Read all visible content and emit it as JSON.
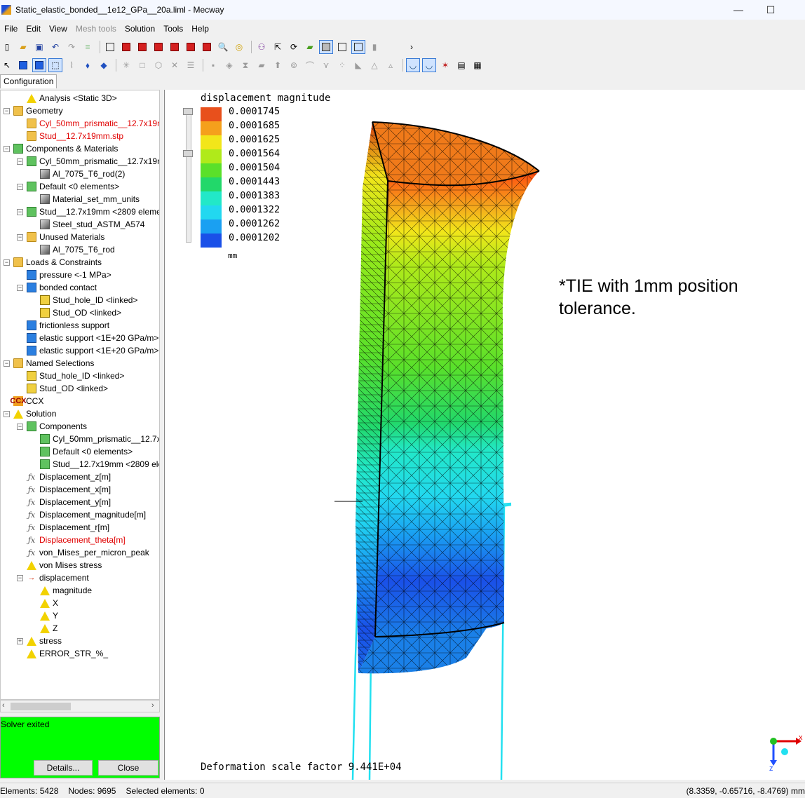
{
  "window": {
    "title": "Static_elastic_bonded__1e12_GPa__20a.liml - Mecway",
    "minimize": "—",
    "maximize": "☐"
  },
  "menu": [
    "File",
    "Edit",
    "View",
    "Mesh tools",
    "Solution",
    "Tools",
    "Help"
  ],
  "tab_label": "Configuration",
  "tree": [
    {
      "depth": 1,
      "icon": "analysis-icon",
      "label": "Analysis <Static 3D>",
      "red": false,
      "expander": ""
    },
    {
      "depth": 0,
      "icon": "folder-icon",
      "label": "Geometry",
      "red": false,
      "expander": "−"
    },
    {
      "depth": 1,
      "icon": "geometry-file-icon",
      "label": "Cyl_50mm_prismatic__12.7x19m",
      "red": true,
      "expander": ""
    },
    {
      "depth": 1,
      "icon": "geometry-file-icon",
      "label": "Stud__12.7x19mm.stp",
      "red": true,
      "expander": ""
    },
    {
      "depth": 0,
      "icon": "components-icon",
      "label": "Components & Materials",
      "red": false,
      "expander": "−"
    },
    {
      "depth": 1,
      "icon": "component-icon",
      "label": "Cyl_50mm_prismatic__12.7x19m",
      "red": false,
      "expander": "−"
    },
    {
      "depth": 2,
      "icon": "material-icon",
      "label": "Al_7075_T6_rod(2)",
      "red": false,
      "expander": ""
    },
    {
      "depth": 1,
      "icon": "component-icon",
      "label": "Default <0 elements>",
      "red": false,
      "expander": "−"
    },
    {
      "depth": 2,
      "icon": "material-icon",
      "label": "Material_set_mm_units",
      "red": false,
      "expander": ""
    },
    {
      "depth": 1,
      "icon": "component-icon",
      "label": "Stud__12.7x19mm <2809 elemer",
      "red": false,
      "expander": "−"
    },
    {
      "depth": 2,
      "icon": "material-icon",
      "label": "Steel_stud_ASTM_A574",
      "red": false,
      "expander": ""
    },
    {
      "depth": 1,
      "icon": "folder-icon",
      "label": "Unused Materials",
      "red": false,
      "expander": "−"
    },
    {
      "depth": 2,
      "icon": "material-icon",
      "label": "Al_7075_T6_rod",
      "red": false,
      "expander": ""
    },
    {
      "depth": 0,
      "icon": "loads-icon",
      "label": "Loads & Constraints",
      "red": false,
      "expander": "−"
    },
    {
      "depth": 1,
      "icon": "pressure-icon",
      "label": "pressure <-1 MPa>",
      "red": false,
      "expander": ""
    },
    {
      "depth": 1,
      "icon": "contact-icon",
      "label": "bonded contact",
      "red": false,
      "expander": "−"
    },
    {
      "depth": 2,
      "icon": "selection-icon",
      "label": "Stud_hole_ID <linked>",
      "red": false,
      "expander": ""
    },
    {
      "depth": 2,
      "icon": "selection-icon",
      "label": "Stud_OD <linked>",
      "red": false,
      "expander": ""
    },
    {
      "depth": 1,
      "icon": "support-icon",
      "label": "frictionless support",
      "red": false,
      "expander": ""
    },
    {
      "depth": 1,
      "icon": "support-icon",
      "label": "elastic support <1E+20 GPa/m>",
      "red": false,
      "expander": ""
    },
    {
      "depth": 1,
      "icon": "support-icon",
      "label": "elastic support <1E+20 GPa/m>",
      "red": false,
      "expander": ""
    },
    {
      "depth": 0,
      "icon": "named-selections-icon",
      "label": "Named Selections",
      "red": false,
      "expander": "−"
    },
    {
      "depth": 1,
      "icon": "selection-icon",
      "label": "Stud_hole_ID <linked>",
      "red": false,
      "expander": ""
    },
    {
      "depth": 1,
      "icon": "selection-icon",
      "label": "Stud_OD <linked>",
      "red": false,
      "expander": ""
    },
    {
      "depth": 0,
      "icon": "ccx-icon",
      "label": "CCX",
      "red": false,
      "expander": ""
    },
    {
      "depth": 0,
      "icon": "solution-icon",
      "label": "Solution",
      "red": false,
      "expander": "−"
    },
    {
      "depth": 1,
      "icon": "components-icon",
      "label": "Components",
      "red": false,
      "expander": "−"
    },
    {
      "depth": 2,
      "icon": "component-hidden-icon",
      "label": "Cyl_50mm_prismatic__12.7x1",
      "red": false,
      "expander": ""
    },
    {
      "depth": 2,
      "icon": "component-icon",
      "label": "Default <0 elements>",
      "red": false,
      "expander": ""
    },
    {
      "depth": 2,
      "icon": "component-icon",
      "label": "Stud__12.7x19mm <2809 ele",
      "red": false,
      "expander": ""
    },
    {
      "depth": 1,
      "icon": "formula-icon",
      "label": "Displacement_z[m]",
      "red": false,
      "expander": ""
    },
    {
      "depth": 1,
      "icon": "formula-icon",
      "label": "Displacement_x[m]",
      "red": false,
      "expander": ""
    },
    {
      "depth": 1,
      "icon": "formula-icon",
      "label": "Displacement_y[m]",
      "red": false,
      "expander": ""
    },
    {
      "depth": 1,
      "icon": "formula-icon",
      "label": "Displacement_magnitude[m]",
      "red": false,
      "expander": ""
    },
    {
      "depth": 1,
      "icon": "formula-icon",
      "label": "Displacement_r[m]",
      "red": false,
      "expander": ""
    },
    {
      "depth": 1,
      "icon": "formula-icon",
      "label": "Displacement_theta[m]",
      "red": true,
      "expander": ""
    },
    {
      "depth": 1,
      "icon": "formula-icon",
      "label": "von_Mises_per_micron_peak",
      "red": false,
      "expander": ""
    },
    {
      "depth": 1,
      "icon": "result-icon",
      "label": "von Mises stress",
      "red": false,
      "expander": ""
    },
    {
      "depth": 1,
      "icon": "displacement-icon",
      "label": "displacement",
      "red": false,
      "expander": "−"
    },
    {
      "depth": 2,
      "icon": "result-icon",
      "label": "magnitude",
      "red": false,
      "expander": ""
    },
    {
      "depth": 2,
      "icon": "result-icon",
      "label": "X",
      "red": false,
      "expander": ""
    },
    {
      "depth": 2,
      "icon": "result-icon",
      "label": "Y",
      "red": false,
      "expander": ""
    },
    {
      "depth": 2,
      "icon": "result-icon",
      "label": "Z",
      "red": false,
      "expander": ""
    },
    {
      "depth": 1,
      "icon": "result-icon",
      "label": "stress",
      "red": false,
      "expander": "+"
    },
    {
      "depth": 1,
      "icon": "result-icon",
      "label": "ERROR_STR_%_",
      "red": false,
      "expander": ""
    }
  ],
  "solver": {
    "status": "Solver exited",
    "details_button": "Details...",
    "close_button": "Close"
  },
  "viewport": {
    "legend_title": "displacement magnitude",
    "legend_values": [
      "0.0001745",
      "0.0001685",
      "0.0001625",
      "0.0001564",
      "0.0001504",
      "0.0001443",
      "0.0001383",
      "0.0001322",
      "0.0001262",
      "0.0001202"
    ],
    "legend_colors": [
      "#e8501c",
      "#f5a01c",
      "#f2e61a",
      "#b0ea1a",
      "#5ae02a",
      "#22d86a",
      "#22e8c8",
      "#22d8f0",
      "#1aa0f2",
      "#1a50e8"
    ],
    "legend_unit": "mm",
    "annotation_line1": "*TIE with 1mm position",
    "annotation_line2": "tolerance.",
    "deformation_text": "Deformation scale factor 9.441E+04",
    "axis_x": "x",
    "axis_z": "z"
  },
  "status": {
    "elements": "Elements: 5428",
    "nodes": "Nodes: 9695",
    "selected": "Selected elements: 0",
    "coords": "(8.3359, -0.65716, -8.4769) mm"
  }
}
